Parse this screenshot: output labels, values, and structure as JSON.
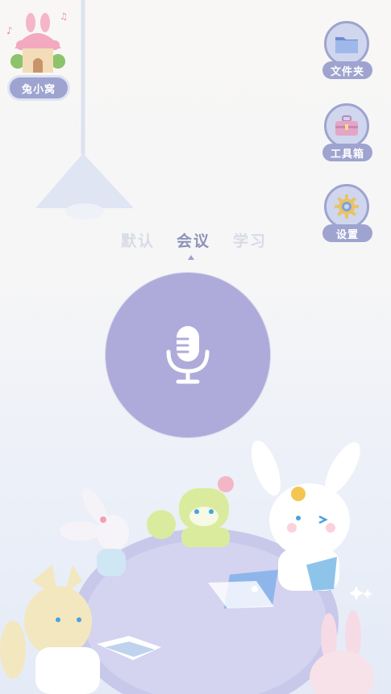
{
  "logo": {
    "label": "兔小窝"
  },
  "side_buttons": [
    {
      "label": "文件夹",
      "icon": "folder-icon"
    },
    {
      "label": "工具箱",
      "icon": "toolbox-icon"
    },
    {
      "label": "设置",
      "icon": "gear-icon"
    }
  ],
  "modes": {
    "items": [
      "默认",
      "会议",
      "学习"
    ],
    "selected": "会议"
  },
  "mic": {
    "icon": "microphone-icon"
  },
  "colors": {
    "accent": "#9ea4cf",
    "mic": "#aeabdb",
    "selected_tab": "#8d93b8",
    "inactive_tab": "#d7dbe6"
  }
}
